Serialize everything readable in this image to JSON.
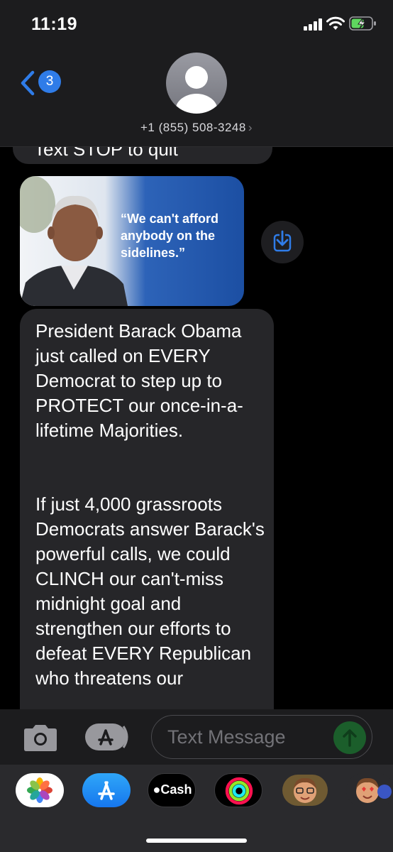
{
  "status_bar": {
    "time": "11:19",
    "signal_icon": "cellular-signal-icon",
    "wifi_icon": "wifi-icon",
    "battery_icon": "battery-charging-icon"
  },
  "header": {
    "back_badge": "3",
    "contact": "+1 (855) 508-3248",
    "contact_chevron": "›"
  },
  "messages": {
    "partial_text": "Text STOP to quit",
    "image_quote": "“We can't afford anybody on the sidelines.”",
    "body_paragraph_1": "President Barack Obama just called on EVERY Democrat to step up to PROTECT our once-in-a-lifetime Majorities.",
    "body_paragraph_2": "If just 4,000 grassroots Democrats answer Barack's powerful calls, we could CLINCH our can't-miss midnight goal and strengthen our efforts to defeat EVERY Republican who threatens our"
  },
  "input": {
    "placeholder": "Text Message"
  },
  "app_drawer": {
    "cash_label": "Cash",
    "apps": [
      "photos-icon",
      "app-store-icon",
      "apple-cash-icon",
      "fitness-icon",
      "memoji-icon",
      "memoji-stickers-icon"
    ]
  },
  "colors": {
    "accent": "#2f7ce8",
    "bubble": "#262629",
    "send_button": "#1b5e2b"
  }
}
